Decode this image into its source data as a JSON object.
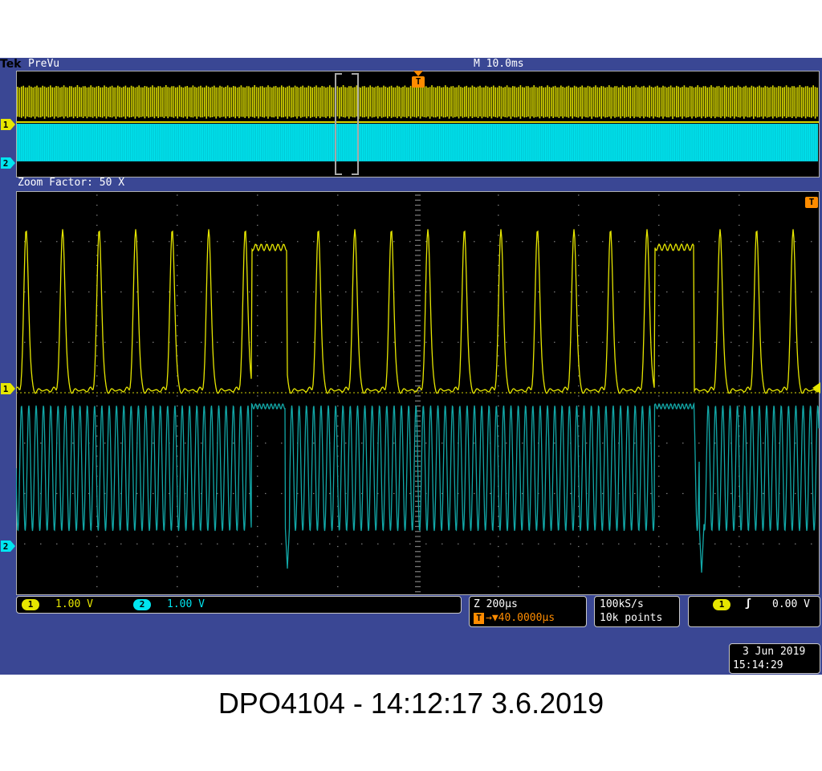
{
  "header": {
    "brand": "Tek",
    "mode": "PreVu",
    "main_timebase": "M 10.0ms"
  },
  "overview": {
    "trigger_marker": "T"
  },
  "zoom": {
    "label": "Zoom Factor: 50 X",
    "trigger_marker": "T"
  },
  "channels": [
    {
      "id": "1",
      "color": "#e6e600",
      "scale": "1.00 V"
    },
    {
      "id": "2",
      "color": "#00e5f0",
      "scale": "1.00 V"
    }
  ],
  "zoom_info": {
    "timebase": "Z 200µs",
    "trigger_marker": "T",
    "trigger_offset": "→▼40.0000µs"
  },
  "acquisition": {
    "sample_rate": "100kS/s",
    "record_length": "10k points"
  },
  "trigger": {
    "channel": "1",
    "slope_icon": "rising-edge-icon",
    "slope_glyph": "ʃ",
    "level": "0.00 V"
  },
  "datetime": {
    "date": "3 Jun  2019",
    "time": "15:14:29"
  },
  "caption": "DPO4104 - 14:12:17   3.6.2019",
  "colors": {
    "background": "#3a4794",
    "ch1": "#e6e600",
    "ch2": "#00e5f0",
    "ch2_zoom": "#12a8a8",
    "trigger": "#ff8c00"
  }
}
